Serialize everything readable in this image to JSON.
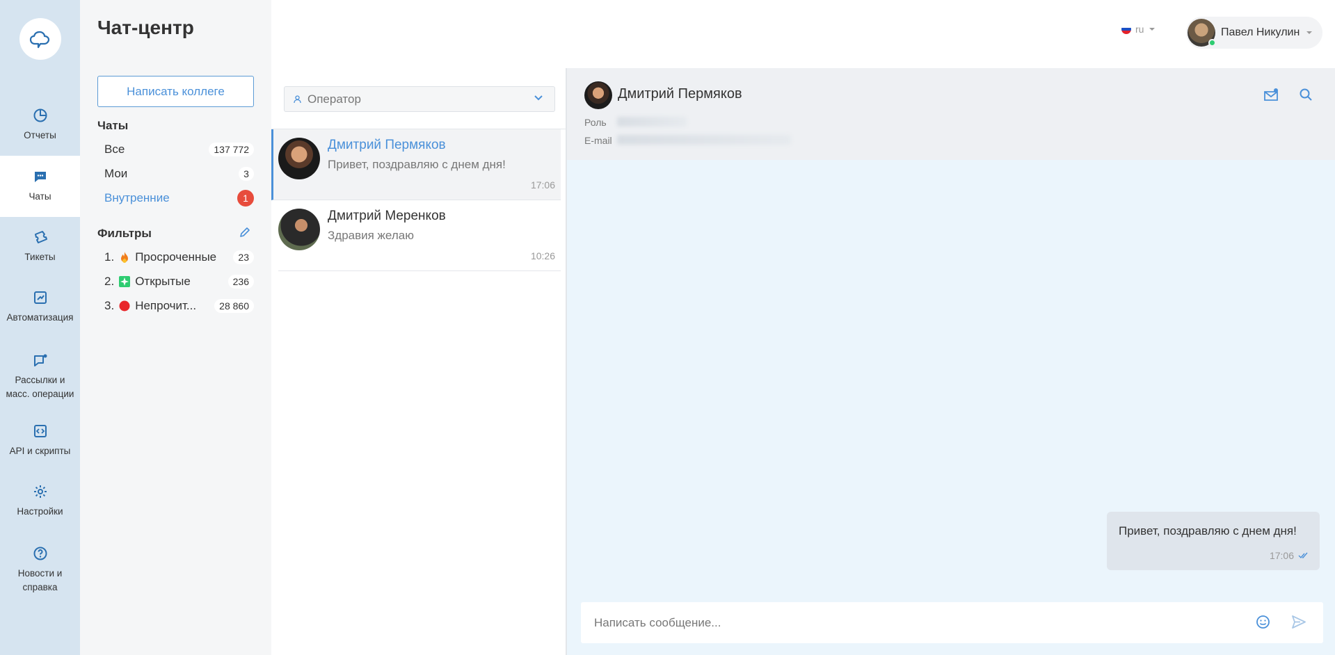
{
  "app": {
    "title": "Чат-центр"
  },
  "rail": {
    "items": [
      {
        "label": "Отчеты",
        "icon": "pie-chart-icon"
      },
      {
        "label": "Чаты",
        "icon": "chat-bubble-icon"
      },
      {
        "label": "Тикеты",
        "icon": "ticket-icon"
      },
      {
        "label": "Автоматизация",
        "icon": "trend-chart-icon"
      },
      {
        "label_lines": [
          "Рассылки и",
          "масс. операции"
        ],
        "icon": "broadcast-icon"
      },
      {
        "label": "API и скрипты",
        "icon": "code-icon"
      },
      {
        "label": "Настройки",
        "icon": "gear-icon"
      },
      {
        "label_lines": [
          "Новости и",
          "справка"
        ],
        "icon": "help-icon"
      }
    ]
  },
  "sidebar": {
    "write_colleague": "Написать коллеге",
    "chats_heading": "Чаты",
    "chats": [
      {
        "label": "Все",
        "count": "137 772"
      },
      {
        "label": "Мои",
        "count": "3"
      },
      {
        "label": "Внутренние",
        "count": "1"
      }
    ],
    "filters_heading": "Фильтры",
    "filters": [
      {
        "num": "1.",
        "label": "Просроченные",
        "count": "23",
        "icon": "fire-icon"
      },
      {
        "num": "2.",
        "label": "Открытые",
        "count": "236",
        "icon": "sparkle-icon"
      },
      {
        "num": "3.",
        "label": "Непрочит...",
        "count": "28 860",
        "icon": "red-dot-icon"
      }
    ]
  },
  "header": {
    "lang": "ru",
    "user_name": "Павел Никулин"
  },
  "list": {
    "operator_placeholder": "Оператор",
    "chats": [
      {
        "name": "Дмитрий Пермяков",
        "preview": "Привет, поздравляю с днем дня!",
        "time": "17:06"
      },
      {
        "name": "Дмитрий Меренков",
        "preview": "Здравия желаю",
        "time": "10:26"
      }
    ]
  },
  "conversation": {
    "contact_name": "Дмитрий Пермяков",
    "role_label": "Роль",
    "email_label": "E-mail",
    "messages": [
      {
        "text": "Привет, поздравляю с днем дня!",
        "time": "17:06"
      }
    ],
    "composer_placeholder": "Написать сообщение..."
  },
  "colors": {
    "accent": "#4a90d9",
    "rail_bg": "#d6e4f0",
    "badge_red": "#e74c3c",
    "chat_bg": "#ebf5fc"
  }
}
